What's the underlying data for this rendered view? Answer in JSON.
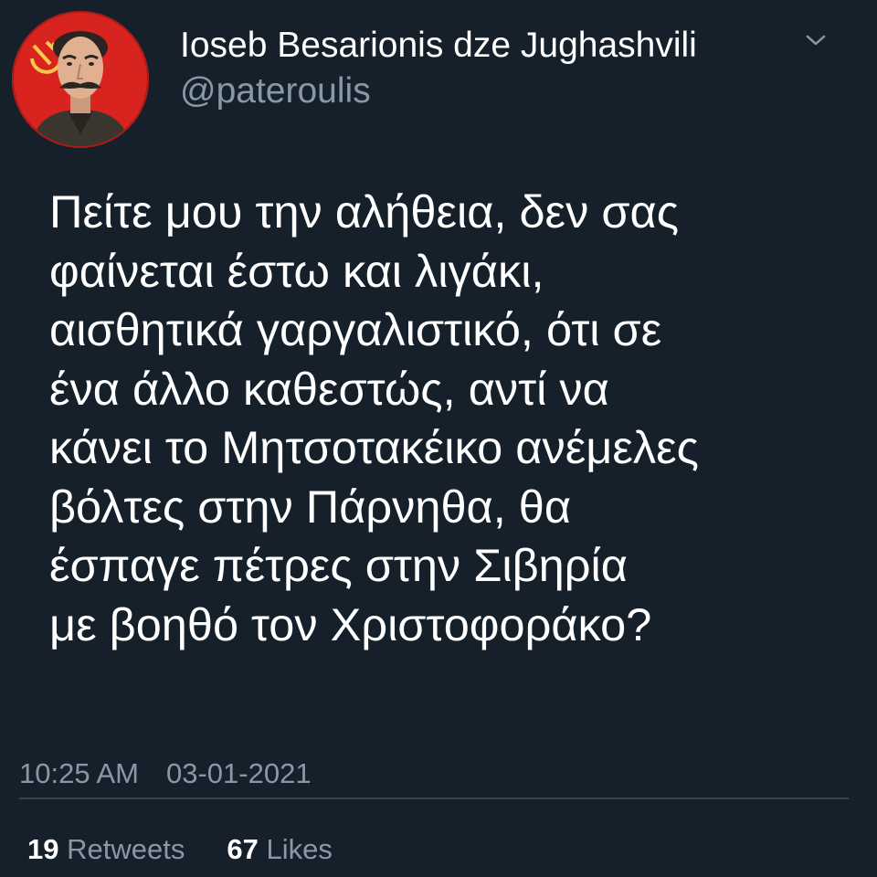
{
  "tweet": {
    "author_name": "Ioseb Besarionis dze Jughashvili",
    "author_handle": "@pateroulis",
    "text": "Πείτε μου την αλήθεια, δεν σας\nφαίνεται έστω και λιγάκι,\nαισθητικά γαργαλιστικό, ότι σε\nένα άλλο καθεστώς, αντί να\nκάνει το Μητσοτακέικο ανέμελες\nβόλτες στην Πάρνηθα, θα\nέσπαγε πέτρες στην Σιβηρία\nμε βοηθό τον Χριστοφοράκο?",
    "time": "10:25 AM",
    "date": "03-01-2021",
    "retweets_count": "19",
    "retweets_label": "Retweets",
    "likes_count": "67",
    "likes_label": "Likes"
  },
  "icons": {
    "menu": "chevron-down-icon",
    "avatar": "avatar-portrait"
  },
  "colors": {
    "background": "#15202b",
    "primary_text": "#ffffff",
    "secondary_text": "#8899a6",
    "divider": "#38444d",
    "avatar_bg": "#d9231f"
  }
}
